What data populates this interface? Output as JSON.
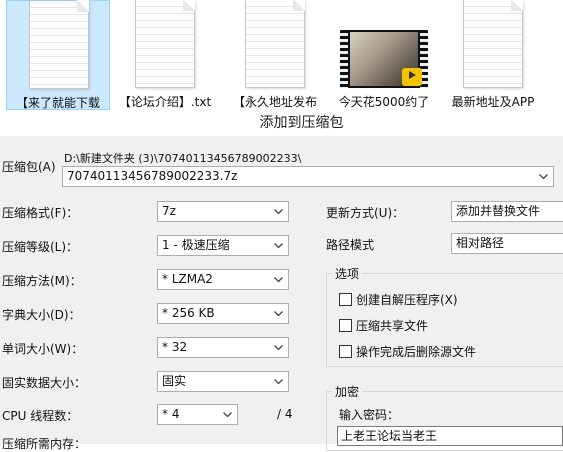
{
  "explorer": {
    "files": [
      {
        "label": "【来了就能下载",
        "icon": "text-file-icon"
      },
      {
        "label": "【论坛介绍】.txt",
        "icon": "text-file-icon"
      },
      {
        "label": "【永久地址发布",
        "icon": "text-file-icon"
      },
      {
        "label": "今天花5000约了",
        "icon": "video-file-icon",
        "badge": "Player"
      },
      {
        "label": "最新地址及APP",
        "icon": "text-file-icon"
      }
    ]
  },
  "dialog": {
    "title": "添加到压缩包",
    "archive": {
      "label": "压缩包(A)",
      "path": "D:\\新建文件夹 (3)\\70740113456789002233\\",
      "filename": "70740113456789002233.7z"
    },
    "left": {
      "format_label": "压缩格式(F)：",
      "format_value": "7z",
      "level_label": "压缩等级(L)：",
      "level_value": "1 - 极速压缩",
      "method_label": "压缩方法(M)：",
      "method_value": "* LZMA2",
      "dict_label": "字典大小(D)：",
      "dict_value": "* 256 KB",
      "word_label": "单词大小(W)：",
      "word_value": "* 32",
      "solid_label": "固实数据大小：",
      "solid_value": "固实",
      "threads_label": "CPU 线程数：",
      "threads_value": "* 4",
      "threads_total": "/ 4",
      "memory_label": "压缩所需内存："
    },
    "right": {
      "update_label": "更新方式(U)：",
      "update_value": "添加并替换文件",
      "pathmode_label": "路径模式",
      "pathmode_value": "相对路径",
      "options_title": "选项",
      "options": [
        {
          "label": "创建自解压程序(X)",
          "checked": false
        },
        {
          "label": "压缩共享文件",
          "checked": false
        },
        {
          "label": "操作完成后删除源文件",
          "checked": false
        }
      ],
      "encryption_title": "加密",
      "password_label": "输入密码：",
      "password_value": "上老王论坛当老王"
    }
  }
}
